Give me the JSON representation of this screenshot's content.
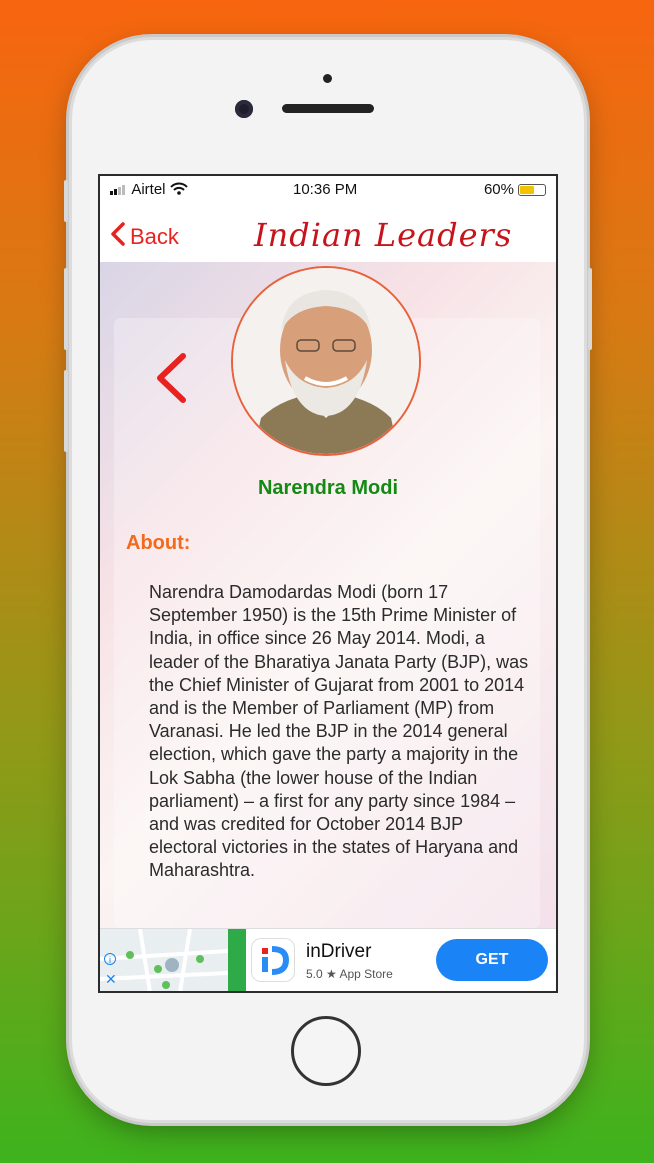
{
  "status_bar": {
    "carrier": "Airtel",
    "time": "10:36 PM",
    "battery": "60%",
    "battery_level": 0.6
  },
  "nav": {
    "back_label": "Back",
    "title": "Indian Leaders"
  },
  "leader": {
    "name": "Narendra Modi",
    "about_heading": "About:",
    "about_text": "Narendra Damodardas Modi (born 17 September 1950) is the 15th Prime Minister of India, in office since 26 May 2014. Modi, a leader of the Bharatiya Janata Party (BJP), was the Chief Minister of Gujarat from 2001 to 2014 and is the Member of Parliament (MP) from Varanasi. He led the BJP in the 2014 general election, which gave the party a majority in the Lok Sabha (the lower house of the Indian parliament) – a first for any party since 1984 – and was credited for October 2014 BJP electoral victories in the states of Haryana and Maharashtra."
  },
  "ad": {
    "app_name": "inDriver",
    "rating": "5.0 ★ App Store",
    "cta": "GET"
  },
  "colors": {
    "accent_red": "#e8221f",
    "title_red": "#c6141c",
    "name_green": "#138a13",
    "about_orange": "#f26a1b",
    "cta_blue": "#1a84f7"
  }
}
